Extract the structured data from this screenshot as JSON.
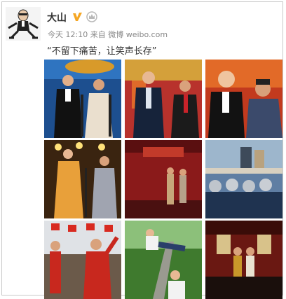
{
  "post": {
    "username": "大山",
    "verified_icon": "verified-v-icon",
    "member_icon": "crown-icon",
    "time": "今天 12:10",
    "source_prefix": "来自",
    "source": "微博 weibo.com",
    "text": "“不留下痛苦，让笑声长存”"
  },
  "colors": {
    "verified": "#f5a623",
    "crown": "#b8b8b8",
    "meta": "#888888",
    "text": "#333333"
  },
  "photos": [
    {
      "name": "photo-crosstalk-duo-blue"
    },
    {
      "name": "photo-performers-red-backdrop"
    },
    {
      "name": "photo-crosstalk-closeup"
    },
    {
      "name": "photo-stage-spotlight"
    },
    {
      "name": "photo-theater-stage"
    },
    {
      "name": "photo-outdoor-crowd-helmets"
    },
    {
      "name": "photo-red-flags-event"
    },
    {
      "name": "photo-tree-acrobatics"
    },
    {
      "name": "photo-performance-hall"
    }
  ]
}
